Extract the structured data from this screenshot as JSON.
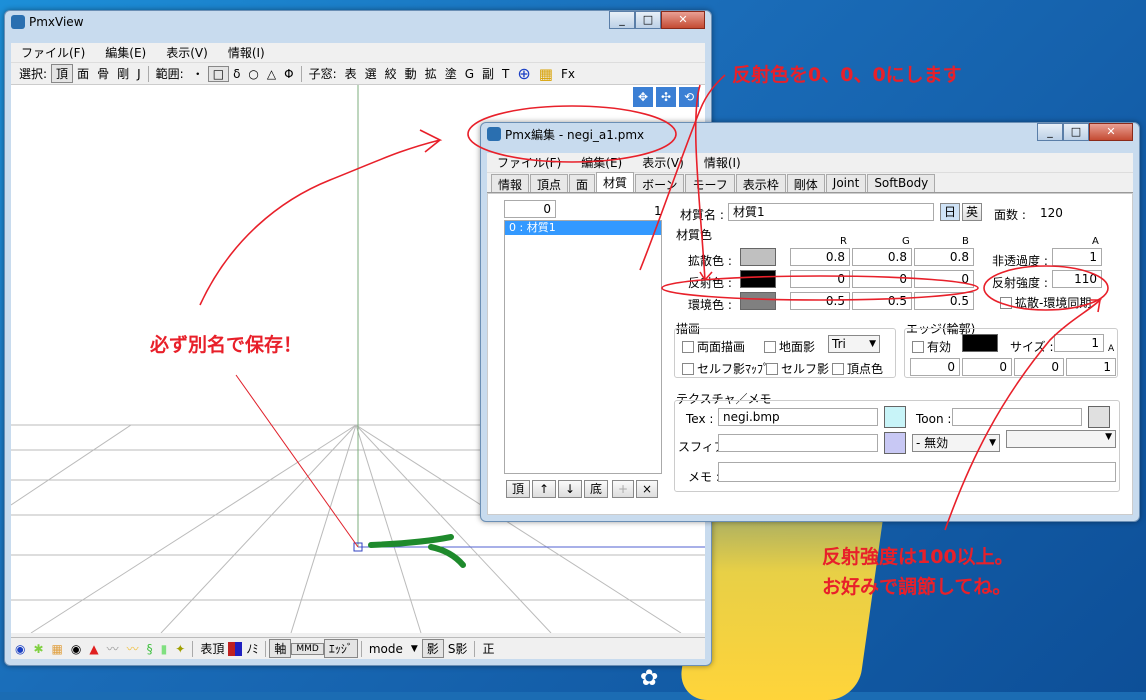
{
  "pmxview": {
    "title": "PmxView",
    "menu": [
      "ファイル(F)",
      "編集(E)",
      "表示(V)",
      "情報(I)"
    ],
    "toolbar": {
      "select_label": "選択:",
      "select_items": [
        "頂",
        "面",
        "骨",
        "剛",
        "J"
      ],
      "range_label": "範囲:",
      "range_items": [
        "・",
        "□",
        "δ",
        "○",
        "△",
        "Φ"
      ],
      "child_label": "子窓:",
      "child_items": [
        "表",
        "選",
        "絞",
        "動",
        "拡",
        "塗",
        "G",
        "副",
        "T"
      ],
      "fx": "Fx"
    },
    "bottom": {
      "items": [
        "表頂",
        "ﾉﾐ",
        "軸",
        "MMD",
        "ｴｯｼﾞ",
        "mode",
        "影",
        "S影",
        "正"
      ]
    }
  },
  "editor": {
    "title": "Pmx編集 - negi_a1.pmx",
    "menu": [
      "ファイル(F)",
      "編集(E)",
      "表示(V)",
      "情報(I)"
    ],
    "tabs": [
      "情報",
      "頂点",
      "面",
      "材質",
      "ボーン",
      "モーフ",
      "表示枠",
      "剛体",
      "Joint",
      "SoftBody"
    ],
    "active_tab": "材質",
    "list": {
      "index": "0",
      "count": "1",
      "items": [
        "0 : 材質1"
      ],
      "buttons": [
        "頂",
        "↑",
        "↓",
        "底",
        "+",
        "×"
      ]
    },
    "material": {
      "name_label": "材質名 :",
      "name_value": "材質1",
      "lang_jp": "日",
      "lang_en": "英",
      "face_count_label": "面数 :",
      "face_count": "120",
      "color_section": "材質色",
      "col_r": "R",
      "col_g": "G",
      "col_b": "B",
      "col_a": "A",
      "diffuse_label": "拡散色 :",
      "diffuse": [
        "0.8",
        "0.8",
        "0.8"
      ],
      "alpha_label": "非透過度 :",
      "alpha": "1",
      "specular_label": "反射色 :",
      "specular": [
        "0",
        "0",
        "0"
      ],
      "specular_power_label": "反射強度 :",
      "specular_power": "110",
      "ambient_label": "環境色 :",
      "ambient": [
        "0.5",
        "0.5",
        "0.5"
      ],
      "sync_label": "拡散-環境同期",
      "diffuse_color": "#c0c0c0",
      "specular_color": "#000000",
      "ambient_color": "#808080"
    },
    "draw": {
      "title": "描画",
      "double_side": "両面描画",
      "ground_shadow": "地面影",
      "tri": "Tri",
      "self_shadow_map": "セルフ影ﾏｯﾌﾟ",
      "self_shadow": "セルフ影",
      "vertex_color": "頂点色"
    },
    "edge": {
      "title": "エッジ(輪郭)",
      "enabled": "有効",
      "size_label": "サイズ :",
      "size": "1",
      "a_label": "A",
      "rgba": [
        "0",
        "0",
        "0",
        "1"
      ]
    },
    "texture": {
      "title": "テクスチャ／メモ",
      "tex_label": "Tex :",
      "tex_value": "negi.bmp",
      "toon_label": "Toon :",
      "sphere_label": "スフィア :",
      "sphere_mode": "- 無効",
      "memo_label": "メモ :"
    }
  },
  "annotations": {
    "specular_note": "反射色を0、0、0にします",
    "save_note": "必ず別名で保存！",
    "power_note_1": "反射強度は100以上。",
    "power_note_2": "お好みで調節してね。"
  }
}
